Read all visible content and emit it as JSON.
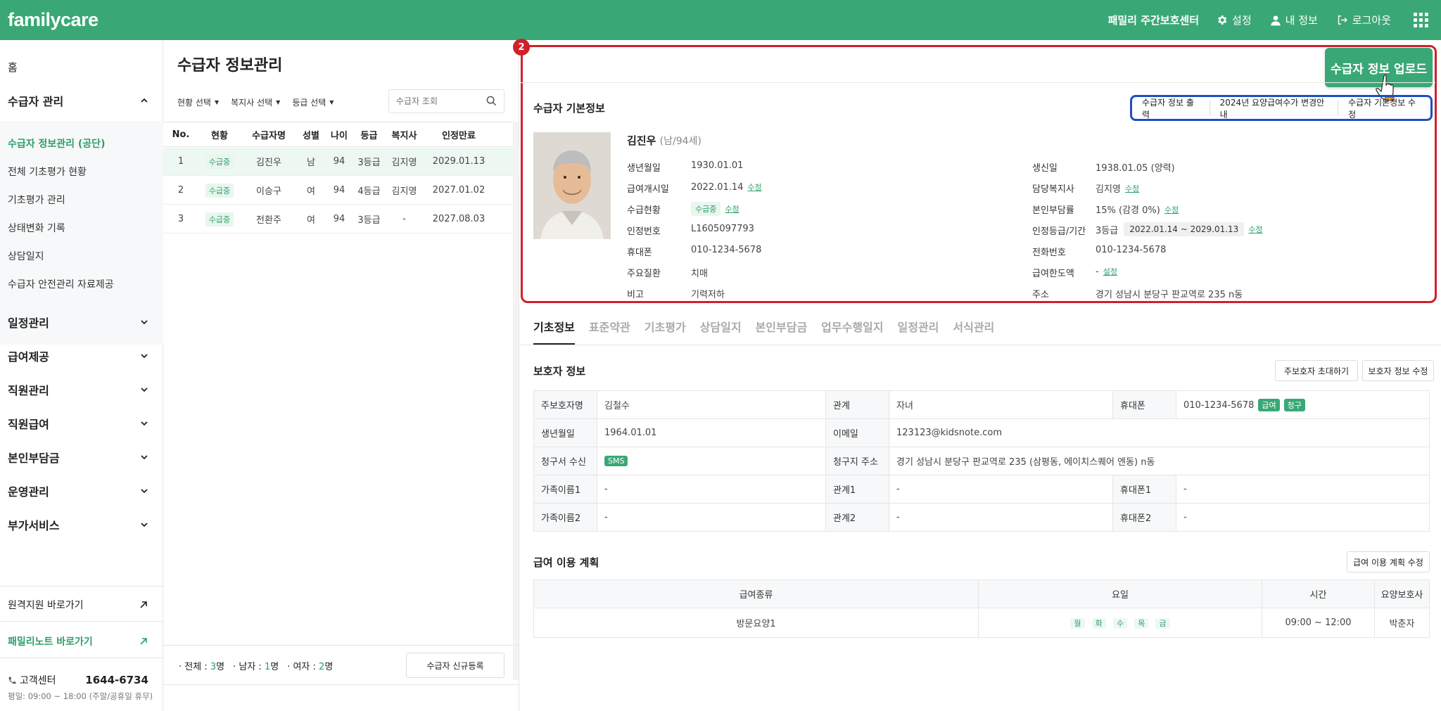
{
  "header": {
    "logo": "familycare",
    "center_name": "패밀리 주간보호센터",
    "settings_label": "설정",
    "my_info_label": "내 정보",
    "logout_label": "로그아웃"
  },
  "sidebar": {
    "home": "홈",
    "section_recipient": "수급자 관리",
    "sub_items": [
      "수급자 정보관리 (공단)",
      "전체 기초평가 현황",
      "기초평가 관리",
      "상태변화 기록",
      "상담일지",
      "수급자 안전관리 자료제공"
    ],
    "sections": [
      "일정관리",
      "급여제공",
      "직원관리",
      "직원급여",
      "본인부담금",
      "운영관리",
      "부가서비스"
    ],
    "remote_link": "원격지원 바로가기",
    "familynote_link": "패밀리노트 바로가기",
    "cs_label": "고객센터",
    "cs_number": "1644-6734",
    "cs_hours": "평일: 09:00 ~ 18:00 (주말/공휴일 휴무)"
  },
  "list": {
    "title": "수급자 정보관리",
    "filters": [
      "현황 선택",
      "복지사 선택",
      "등급 선택"
    ],
    "search_placeholder": "수급자 조회",
    "columns": [
      "No.",
      "현황",
      "수급자명",
      "성별",
      "나이",
      "등급",
      "복지사",
      "인정만료"
    ],
    "rows": [
      {
        "no": "1",
        "status": "수급중",
        "name": "김진우",
        "sex": "남",
        "age": "94",
        "grade": "3등급",
        "worker": "김지영",
        "expiry": "2029.01.13"
      },
      {
        "no": "2",
        "status": "수급중",
        "name": "이승구",
        "sex": "여",
        "age": "94",
        "grade": "4등급",
        "worker": "김지영",
        "expiry": "2027.01.02"
      },
      {
        "no": "3",
        "status": "수급중",
        "name": "전환주",
        "sex": "여",
        "age": "94",
        "grade": "3등급",
        "worker": "-",
        "expiry": "2027.08.03"
      }
    ],
    "count_total_label": "전체 : ",
    "count_total": "3",
    "count_total_unit": "명",
    "count_male_label": "남자 : ",
    "count_male": "1",
    "count_male_unit": "명",
    "count_female_label": "여자 : ",
    "count_female": "2",
    "count_female_unit": "명",
    "new_button": "수급자 신규등록"
  },
  "detail": {
    "marker_number": "2",
    "upload_button": "수급자 정보 업로드",
    "basic_title": "수급자 기본정보",
    "actions": [
      "수급자 정보 출력",
      "2024년 요양급여수가 변경안내",
      "수급자 기본정보 수정"
    ],
    "name": "김진우",
    "name_sub": "(남/94세)",
    "left_fields": [
      {
        "label": "생년월일",
        "value": "1930.01.01"
      },
      {
        "label": "급여개시일",
        "value": "2022.01.14",
        "link": "수정"
      },
      {
        "label": "수급현황",
        "pill": "수급중",
        "link": "수정"
      },
      {
        "label": "인정번호",
        "value": "L1605097793"
      },
      {
        "label": "휴대폰",
        "value": "010-1234-5678"
      },
      {
        "label": "주요질환",
        "value": "치매"
      },
      {
        "label": "비고",
        "value": "기력저하"
      }
    ],
    "right_fields": [
      {
        "label": "생신일",
        "value": "1938.01.05 (양력)"
      },
      {
        "label": "담당복지사",
        "value": "김지영",
        "link": "수정"
      },
      {
        "label": "본인부담률",
        "value": "15% (감경 0%)",
        "link": "수정"
      },
      {
        "label": "인정등급/기간",
        "value": "3등급",
        "pill": "2022.01.14 ~ 2029.01.13",
        "link": "수정"
      },
      {
        "label": "전화번호",
        "value": "010-1234-5678"
      },
      {
        "label": "급여한도액",
        "value": "-",
        "link": "설정"
      },
      {
        "label": "주소",
        "value": "경기 성남시 분당구 판교역로 235 n동"
      }
    ],
    "tabs": [
      "기초정보",
      "표준약관",
      "기초평가",
      "상담일지",
      "본인부담금",
      "업무수행일지",
      "일정관리",
      "서식관리"
    ],
    "guardian_title": "보호자 정보",
    "guardian_invite": "주보호자 초대하기",
    "guardian_edit": "보호자 정보 수정",
    "guardian": {
      "main_name_label": "주보호자명",
      "main_name": "김철수",
      "relation_label": "관계",
      "relation": "자녀",
      "phone_label": "휴대폰",
      "phone": "010-1234-5678",
      "tag1": "급여",
      "tag2": "청구",
      "birth_label": "생년월일",
      "birth": "1964.01.01",
      "email_label": "이메일",
      "email": "123123@kidsnote.com",
      "bill_label": "청구서 수신",
      "bill": "SMS",
      "bill_addr_label": "청구지 주소",
      "bill_addr": "경기 성남시 분당구 판교역로 235 (삼평동, 에이치스퀘어 엔동) n동",
      "fam1_label": "가족이름1",
      "fam1": "-",
      "rel1_label": "관계1",
      "rel1": "-",
      "ph1_label": "휴대폰1",
      "ph1": "-",
      "fam2_label": "가족이름2",
      "fam2": "-",
      "rel2_label": "관계2",
      "rel2": "-",
      "ph2_label": "휴대폰2",
      "ph2": "-"
    },
    "plan_title": "급여 이용 계획",
    "plan_edit": "급여 이용 계획 수정",
    "plan_columns": [
      "급여종류",
      "요일",
      "시간",
      "요양보호사"
    ],
    "plan_row": {
      "type": "방문요양1",
      "days": [
        "월",
        "화",
        "수",
        "목",
        "금"
      ],
      "time": "09:00 ~ 12:00",
      "caregiver": "박춘자"
    }
  }
}
